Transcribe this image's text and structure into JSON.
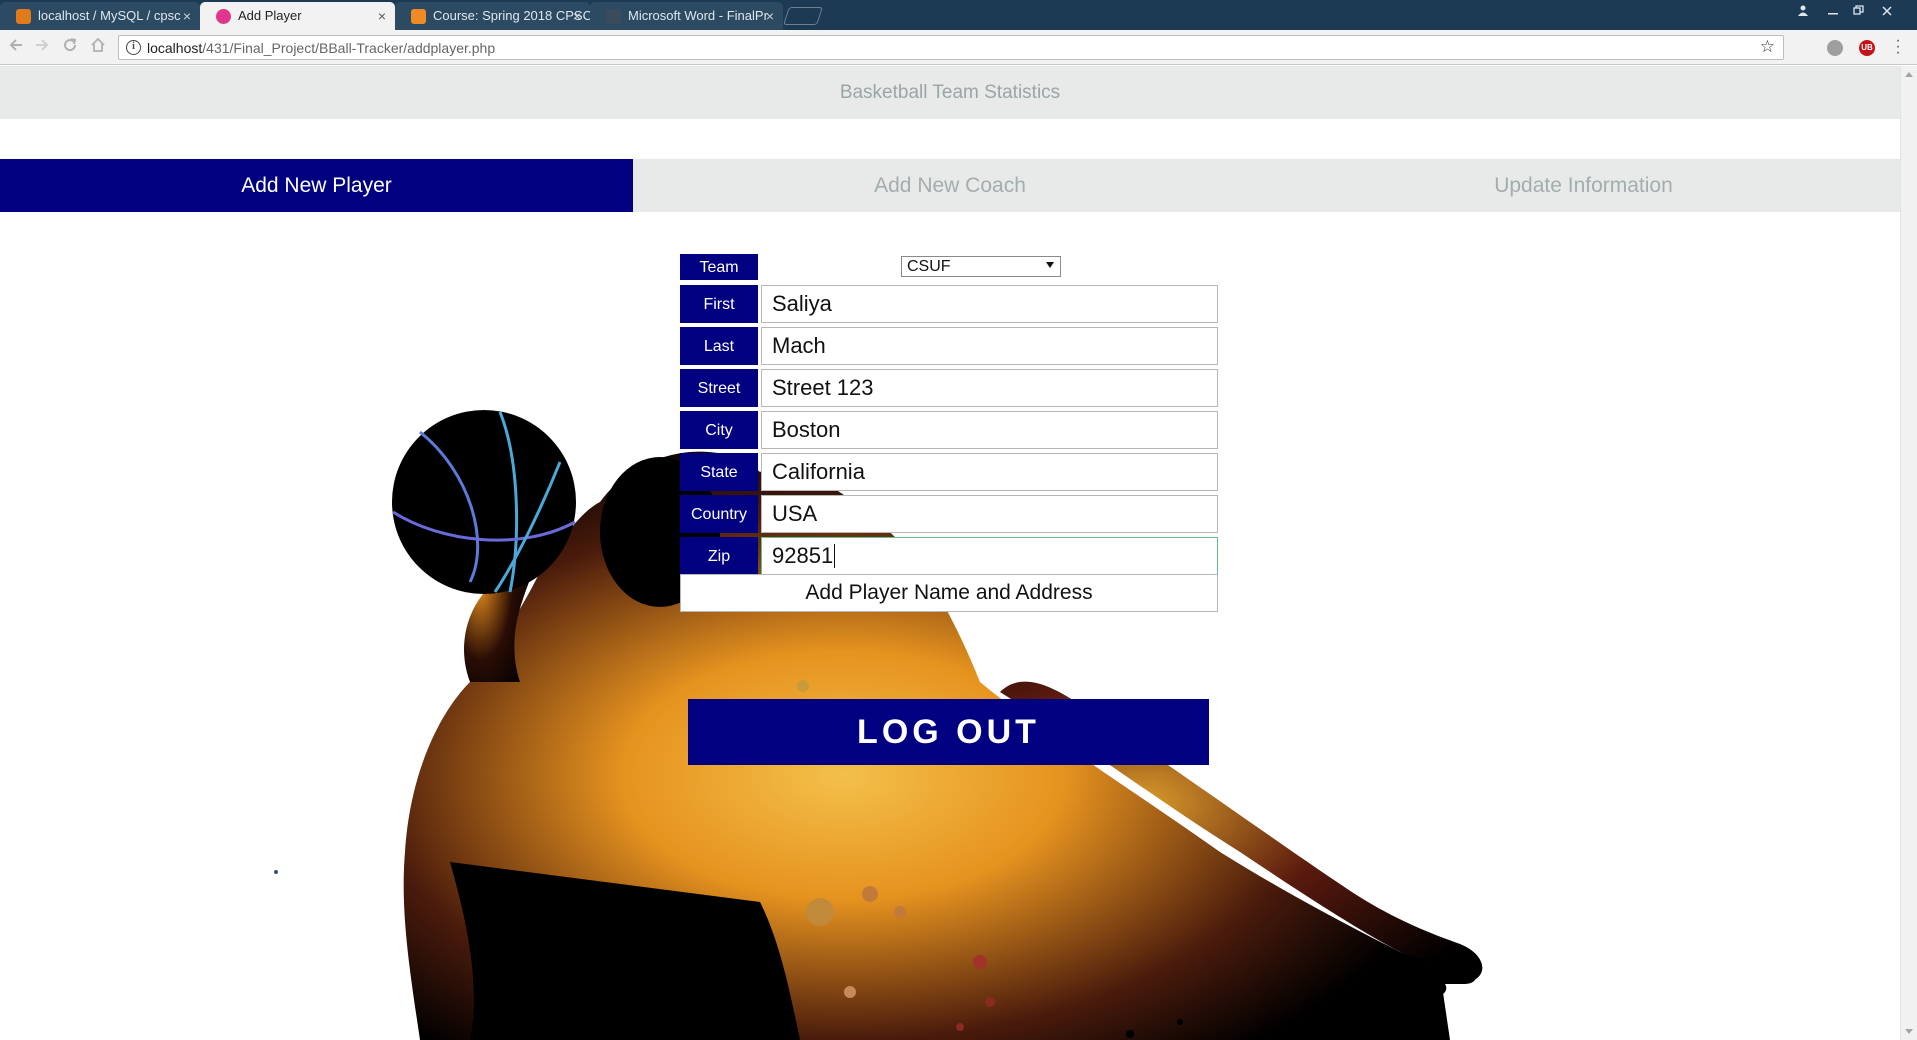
{
  "browser": {
    "tabs": [
      {
        "title": "localhost / MySQL / cpsc",
        "active": false,
        "favicon_color": "#e07b1b"
      },
      {
        "title": "Add Player",
        "active": true,
        "favicon_color": "#e2358e"
      },
      {
        "title": "Course: Spring 2018 CPSC",
        "active": false,
        "favicon_color": "#f08a24"
      },
      {
        "title": "Microsoft Word - FinalPr",
        "active": false,
        "favicon_color": "#3a4b5c"
      }
    ],
    "tab_close_glyph": "×",
    "url_host": "localhost",
    "url_path": "/431/Final_Project/BBall-Tracker/addplayer.php",
    "bookmark_glyph": "☆",
    "ext_ub_label": "UB"
  },
  "site": {
    "header_title": "Basketball Team Statistics",
    "nav": [
      {
        "label": "Add New Player",
        "active": true
      },
      {
        "label": "Add New Coach",
        "active": false
      },
      {
        "label": "Update Information",
        "active": false
      }
    ]
  },
  "form": {
    "team": {
      "label": "Team",
      "value": "CSUF"
    },
    "fields": [
      {
        "label": "First Name",
        "value": "Saliya"
      },
      {
        "label": "Last Name",
        "value": "Mach"
      },
      {
        "label": "Street",
        "value": "Street 123"
      },
      {
        "label": "City",
        "value": "Boston"
      },
      {
        "label": "State",
        "value": "California"
      },
      {
        "label": "Country",
        "value": "USA"
      },
      {
        "label": "Zip",
        "value": "92851"
      }
    ],
    "submit_label": "Add Player Name and Address"
  },
  "logout_label": "LOG OUT",
  "colors": {
    "brand_navy": "#000080",
    "header_gray": "#e8eaea",
    "header_text": "#9aa5a5",
    "focus_green": "#5bc48e"
  }
}
